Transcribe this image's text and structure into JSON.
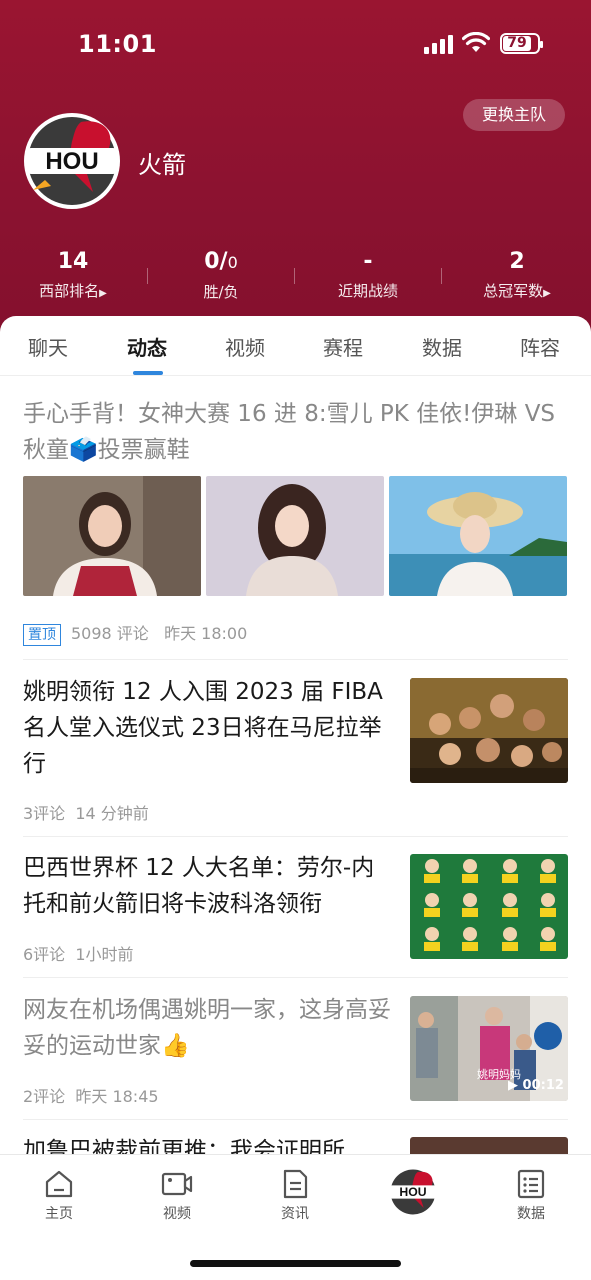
{
  "status_bar": {
    "time": "11:01",
    "battery": "79"
  },
  "team": {
    "name": "火箭",
    "logo_text": "HOU",
    "switch_label": "更换主队"
  },
  "stats": [
    {
      "value": "14",
      "label": "西部排名",
      "arrow": "▶"
    },
    {
      "value": "0/",
      "value_small": "0",
      "label": "胜/负",
      "arrow": ""
    },
    {
      "value": "-",
      "label": "近期战绩",
      "arrow": ""
    },
    {
      "value": "2",
      "label": "总冠军数",
      "arrow": "▶"
    }
  ],
  "tabs": [
    {
      "label": "聊天",
      "active": false
    },
    {
      "label": "动态",
      "active": true
    },
    {
      "label": "视频",
      "active": false
    },
    {
      "label": "赛程",
      "active": false
    },
    {
      "label": "数据",
      "active": false
    },
    {
      "label": "阵容",
      "active": false
    }
  ],
  "pinned_article": {
    "title": "手心手背！女神大赛 16 进 8:雪儿 PK 佳依!伊琳 VS 秋童🗳️投票赢鞋",
    "badge": "置顶",
    "comments": "5098 评论",
    "time": "昨天 18:00"
  },
  "news": [
    {
      "title": "姚明领衔 12 人入围 2023 届 FIBA 名人堂入选仪式 23日将在马尼拉举行",
      "comments": "3评论",
      "time": "14 分钟前",
      "read": false
    },
    {
      "title": "巴西世界杯 12 人大名单：劳尔-内托和前火箭旧将卡波科洛领衔",
      "comments": "6评论",
      "time": "1小时前",
      "read": false
    },
    {
      "title": "网友在机场偶遇姚明一家，这身高妥妥的运动世家👍",
      "comments": "2评论",
      "time": "昨天 18:45",
      "read": true,
      "video_duration": "▶ 00:12",
      "caption": "姚明妈妈"
    },
    {
      "title": "加鲁巴被裁前更推：我会证明所",
      "comments": "",
      "time": "",
      "read": false
    }
  ],
  "bottom_nav": [
    {
      "label": "主页",
      "icon": "home-icon"
    },
    {
      "label": "视频",
      "icon": "video-icon"
    },
    {
      "label": "资讯",
      "icon": "document-icon"
    },
    {
      "label": "",
      "icon": "team-logo-icon"
    },
    {
      "label": "数据",
      "icon": "data-list-icon"
    }
  ],
  "colors": {
    "header": "#8b1230",
    "accent": "#2f86dd"
  }
}
